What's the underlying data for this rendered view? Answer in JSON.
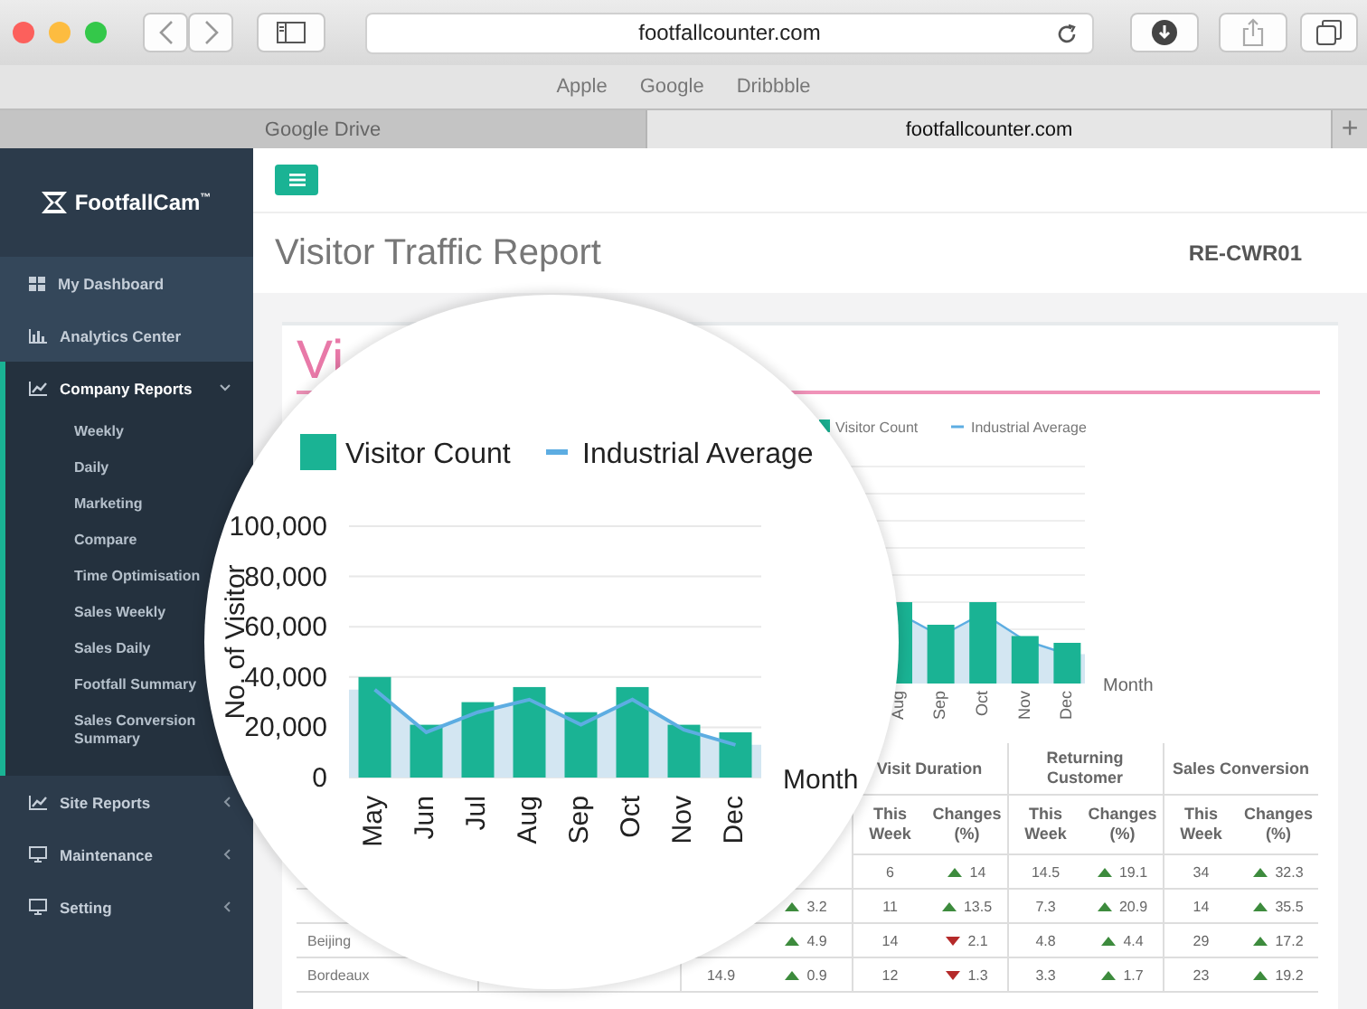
{
  "browser": {
    "url": "footfallcounter.com",
    "bookmarks": [
      "Apple",
      "Google",
      "Dribbble"
    ],
    "tabs": [
      {
        "label": "Google Drive",
        "selected": false
      },
      {
        "label": "footfallcounter.com",
        "selected": true
      }
    ],
    "new_tab": "+"
  },
  "sidebar": {
    "logo": "FootfallCam",
    "logo_mark": "™",
    "items": [
      {
        "label": "My Dashboard"
      },
      {
        "label": "Analytics Center"
      },
      {
        "label": "Company Reports",
        "expanded": true,
        "children": [
          {
            "label": "Weekly"
          },
          {
            "label": "Daily"
          },
          {
            "label": "Marketing"
          },
          {
            "label": "Compare"
          },
          {
            "label": "Time Optimisation"
          },
          {
            "label": "Sales Weekly"
          },
          {
            "label": "Sales Daily"
          },
          {
            "label": "Footfall Summary"
          },
          {
            "label": "Sales Conversion Summary"
          }
        ]
      },
      {
        "label": "Site Reports",
        "expanded": false
      },
      {
        "label": "Maintenance",
        "expanded": false
      },
      {
        "label": "Setting",
        "expanded": false
      }
    ]
  },
  "header": {
    "title": "Visitor Traffic Report",
    "code": "RE-CWR01"
  },
  "card": {
    "title": "Vi",
    "legend": [
      "Visitor Count",
      "Industrial Average"
    ],
    "x_labels": [
      "Aug",
      "Sep",
      "Oct",
      "Nov",
      "Dec"
    ],
    "xlabel": "Month"
  },
  "table": {
    "groups": [
      {
        "label": "Visit Duration",
        "this_week": "This Week",
        "changes": "Changes (%)"
      },
      {
        "label": "Returning Customer",
        "this_week": "This Week",
        "changes": "Changes (%)"
      },
      {
        "label": "Sales Conversion",
        "this_week": "This Week",
        "changes": "Changes (%)"
      }
    ],
    "rows": [
      {
        "cells": [
          null,
          null,
          {
            "kind": "value",
            "text": "6"
          },
          {
            "kind": "change",
            "increase": true,
            "text": "14"
          },
          {
            "kind": "value",
            "text": "14.5"
          },
          {
            "kind": "change",
            "increase": true,
            "text": "19.1"
          },
          {
            "kind": "value",
            "text": "34"
          },
          {
            "kind": "change",
            "increase": true,
            "text": "32.3"
          }
        ]
      },
      {
        "cells": [
          null,
          {
            "kind": "change",
            "increase": true,
            "text": "3.2"
          },
          {
            "kind": "value",
            "text": "11"
          },
          {
            "kind": "change",
            "increase": true,
            "text": "13.5"
          },
          {
            "kind": "value",
            "text": "7.3"
          },
          {
            "kind": "change",
            "increase": true,
            "text": "20.9"
          },
          {
            "kind": "value",
            "text": "14"
          },
          {
            "kind": "change",
            "increase": true,
            "text": "35.5"
          }
        ]
      },
      {
        "store": "Beijing",
        "cells": [
          null,
          {
            "kind": "change",
            "increase": true,
            "text": "4.9"
          },
          {
            "kind": "value",
            "text": "14"
          },
          {
            "kind": "change",
            "increase": false,
            "text": "2.1"
          },
          {
            "kind": "value",
            "text": "4.8"
          },
          {
            "kind": "change",
            "increase": true,
            "text": "4.4"
          },
          {
            "kind": "value",
            "text": "29"
          },
          {
            "kind": "change",
            "increase": true,
            "text": "17.2"
          }
        ]
      },
      {
        "store": "Bordeaux",
        "cells": [
          {
            "kind": "value",
            "text": "14.9"
          },
          {
            "kind": "change",
            "increase": true,
            "text": "0.9"
          },
          {
            "kind": "value",
            "text": "12"
          },
          {
            "kind": "change",
            "increase": false,
            "text": "1.3"
          },
          {
            "kind": "value",
            "text": "3.3"
          },
          {
            "kind": "change",
            "increase": true,
            "text": "1.7"
          },
          {
            "kind": "value",
            "text": "23"
          },
          {
            "kind": "change",
            "increase": true,
            "text": "19.2"
          }
        ]
      }
    ]
  },
  "magnifier": {
    "chart_data": {
      "type": "bar",
      "xlabel": "Month",
      "ylabel": "No. of Visitor",
      "categories": [
        "May",
        "Jun",
        "Jul",
        "Aug",
        "Sep",
        "Oct",
        "Nov",
        "Dec"
      ],
      "series": [
        {
          "name": "Visitor Count",
          "type": "bar",
          "color": "#1ab394",
          "values": [
            40000,
            21000,
            30000,
            36000,
            26000,
            36000,
            21000,
            18000
          ]
        },
        {
          "name": "Industrial Average",
          "type": "line",
          "color": "#5dade2",
          "values": [
            35000,
            18000,
            26000,
            31000,
            21000,
            31000,
            19000,
            13000
          ]
        }
      ],
      "ylim": [
        0,
        100000
      ],
      "grid": true,
      "legend": "top",
      "yticks": [
        {
          "value": 0,
          "label": "0"
        },
        {
          "value": 20000,
          "label": "20,000"
        },
        {
          "value": 40000,
          "label": "40,000"
        },
        {
          "value": 60000,
          "label": "60,000"
        },
        {
          "value": 80000,
          "label": "80,000"
        },
        {
          "value": 100000,
          "label": "100,000"
        }
      ]
    }
  }
}
